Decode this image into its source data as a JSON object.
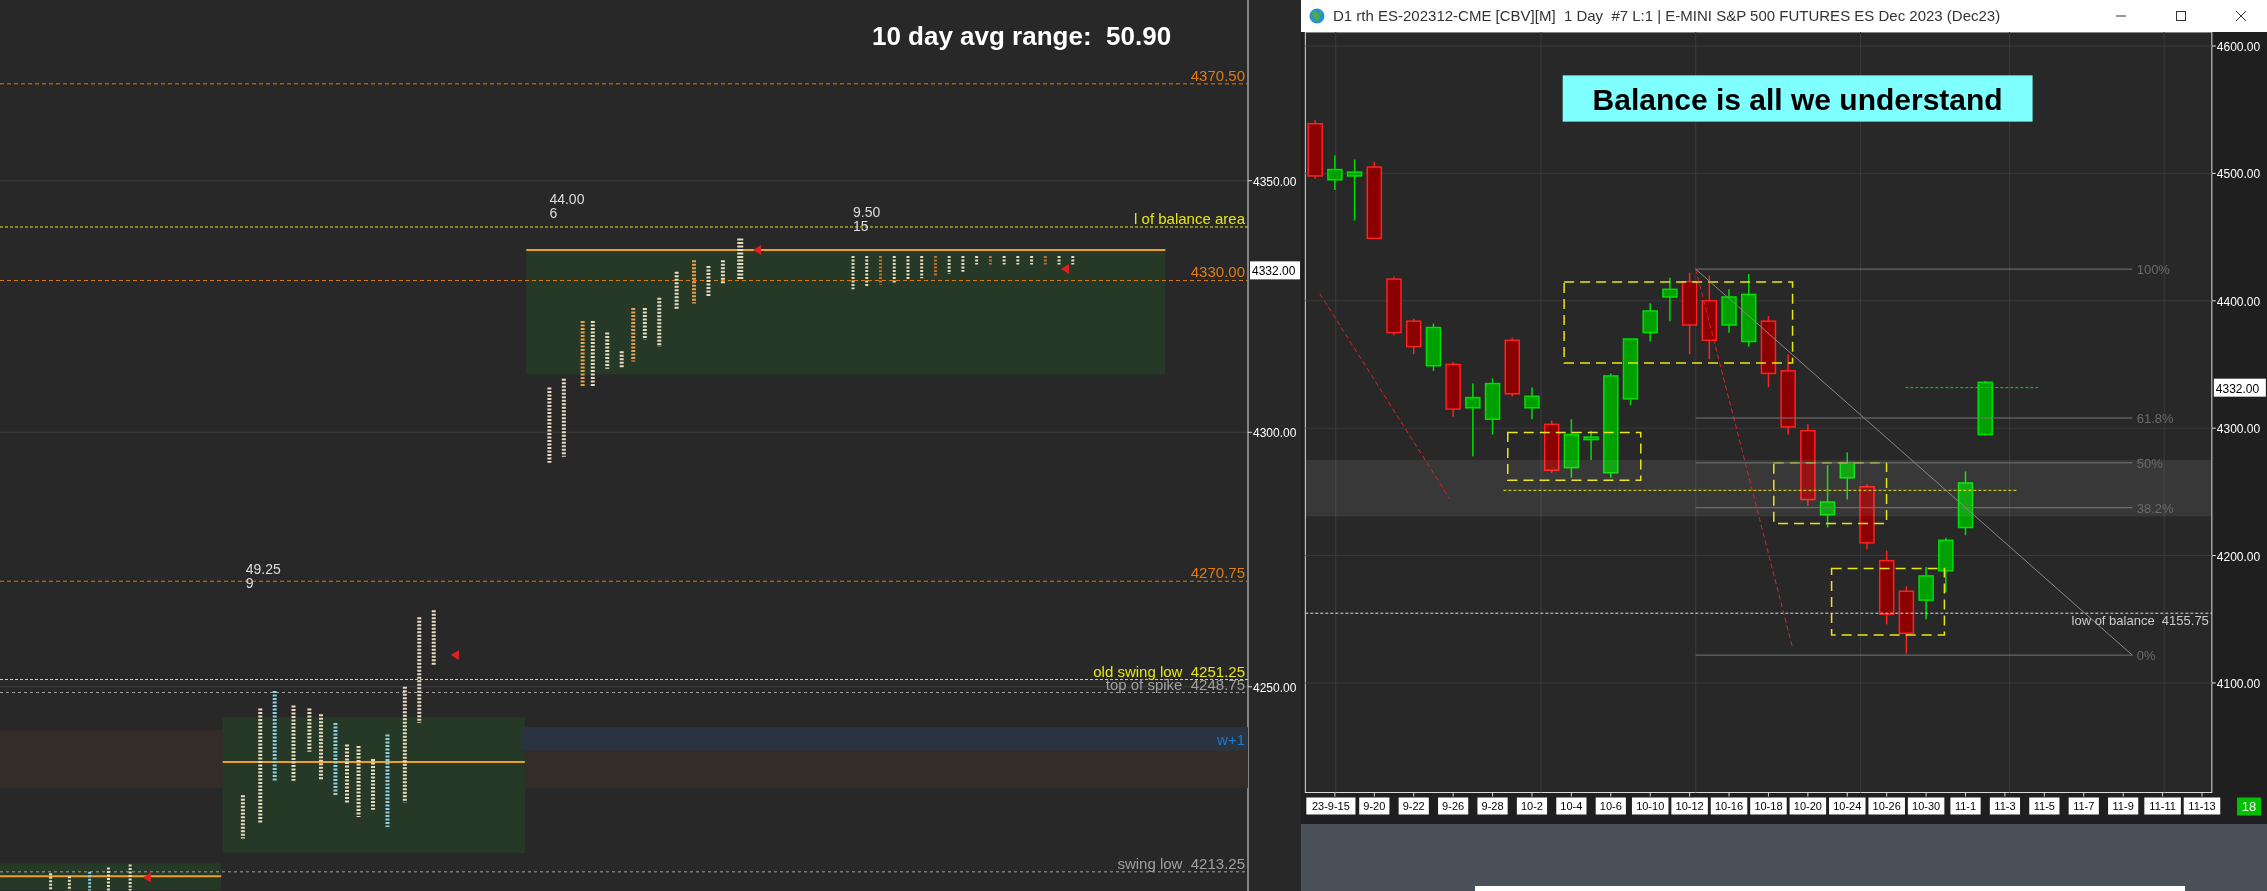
{
  "left_chart": {
    "title": "10 day avg range:  50.90",
    "range_stats": [
      {
        "range": "49.25",
        "count": "9"
      },
      {
        "range": "44.00",
        "count": "6"
      },
      {
        "range": "9.50",
        "count": "15"
      }
    ],
    "level_labels": [
      {
        "text": "4370.50",
        "kind": "target"
      },
      {
        "text": "l of balance area",
        "kind": "balance"
      },
      {
        "text": "4330.00",
        "kind": "target"
      },
      {
        "text": "4270.75",
        "kind": "target"
      },
      {
        "text": "old swing low  4251.25",
        "kind": "balance"
      },
      {
        "text": "top of spike  4248.75",
        "kind": "reference"
      },
      {
        "text": "w+1",
        "kind": "week"
      },
      {
        "text": "swing low  4213.25",
        "kind": "reference"
      }
    ],
    "y_axis": [
      "4350.00",
      "4300.00",
      "4250.00"
    ],
    "current_price": "4332.00"
  },
  "chart_window": {
    "title": "D1 rth ES-202312-CME [CBV][M]  1 Day  #7 L:1 | E-MINI S&P 500 FUTURES ES Dec 2023 (Dec23)",
    "annotation": "Balance is all we understand",
    "fib_labels": [
      "100%",
      "61.8%",
      "50%",
      "38.2%",
      "0%"
    ],
    "low_of_balance": "low of balance  4155.75",
    "current_price": "4332.00",
    "bar_count": "18",
    "chart_data": {
      "type": "candlestick",
      "categories": [
        null,
        "23-9-15",
        null,
        "9-20",
        null,
        "9-22",
        null,
        "9-26",
        null,
        "9-28",
        null,
        "10-2",
        null,
        "10-4",
        null,
        "10-6",
        null,
        "10-10",
        null,
        "10-12",
        null,
        "10-16",
        null,
        "10-18",
        null,
        "10-20",
        null,
        "10-24",
        null,
        "10-26",
        null,
        "10-30",
        null,
        "11-1",
        null,
        "11-3",
        null,
        "11-5",
        null,
        "11-7",
        null,
        "11-9",
        null,
        "11-11",
        null,
        "11-13"
      ],
      "ohlc": [
        [
          4539,
          4542,
          4496,
          4498
        ],
        [
          4495,
          4514,
          4487,
          4503
        ],
        [
          4498,
          4511,
          4463,
          4501
        ],
        [
          4505,
          4509,
          4449,
          4449
        ],
        [
          4417,
          4419,
          4373,
          4375
        ],
        [
          4384,
          4386,
          4358,
          4364
        ],
        [
          4349,
          4382,
          4345,
          4379
        ],
        [
          4350,
          4352,
          4309,
          4315
        ],
        [
          4316,
          4335,
          4278,
          4324
        ],
        [
          4307,
          4339,
          4295,
          4335
        ],
        [
          4369,
          4371,
          4325,
          4327
        ],
        [
          4316,
          4332,
          4307,
          4325
        ],
        [
          4303,
          4306,
          4265,
          4267
        ],
        [
          4269,
          4307,
          4261,
          4295
        ],
        [
          4291,
          4298,
          4275,
          4293
        ],
        [
          4265,
          4343,
          4261,
          4341
        ],
        [
          4323,
          4370,
          4318,
          4370
        ],
        [
          4375,
          4398,
          4368,
          4392
        ],
        [
          4403,
          4418,
          4384,
          4409
        ],
        [
          4415,
          4422,
          4358,
          4381
        ],
        [
          4400,
          4420,
          4354,
          4369
        ],
        [
          4381,
          4409,
          4375,
          4403
        ],
        [
          4368,
          4421,
          4364,
          4405
        ],
        [
          4384,
          4388,
          4332,
          4343
        ],
        [
          4345,
          4358,
          4295,
          4301
        ],
        [
          4298,
          4303,
          4239,
          4244
        ],
        [
          4232,
          4271,
          4222,
          4242
        ],
        [
          4261,
          4281,
          4244,
          4273
        ],
        [
          4254,
          4256,
          4205,
          4210
        ],
        [
          4196,
          4204,
          4146,
          4154
        ],
        [
          4172,
          4176,
          4123,
          4139
        ],
        [
          4165,
          4191,
          4150,
          4184
        ],
        [
          4188,
          4214,
          4171,
          4212
        ],
        [
          4222,
          4266,
          4216,
          4257
        ],
        [
          4295,
          4337,
          4294,
          4336
        ],
        null,
        null,
        null,
        null,
        null,
        null,
        null,
        null,
        null,
        null,
        null
      ],
      "grid": true,
      "ylim": [
        4014,
        4611
      ],
      "yticks": [
        {
          "value": 4600,
          "label": "4600.00"
        },
        {
          "value": 4500,
          "label": "4500.00"
        },
        {
          "value": 4400,
          "label": "4400.00"
        },
        {
          "value": 4300,
          "label": "4300.00"
        },
        {
          "value": 4200,
          "label": "4200.00"
        },
        {
          "value": 4100,
          "label": "4100.00"
        }
      ]
    }
  }
}
